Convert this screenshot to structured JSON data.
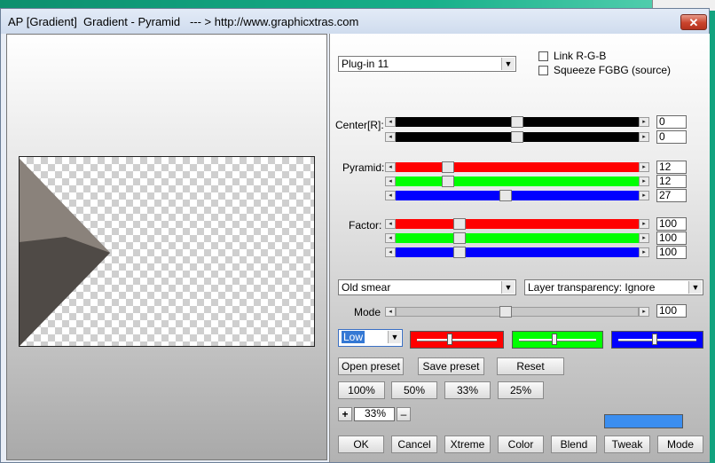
{
  "window": {
    "title": "AP [Gradient]  Gradient - Pyramid   --- > http://www.graphicxtras.com",
    "close_glyph": "✕"
  },
  "controls": {
    "plugin_select": {
      "value": "Plug-in 11"
    },
    "checkboxes": [
      {
        "label": "Link R-G-B",
        "checked": false
      },
      {
        "label": "Squeeze FGBG (source)",
        "checked": false
      }
    ]
  },
  "groups": {
    "center": {
      "label": "Center[R]:",
      "sliders": [
        {
          "color": "#000000",
          "value": "0",
          "fraction": 0.5
        },
        {
          "color": "#000000",
          "value": "0",
          "fraction": 0.5
        }
      ]
    },
    "pyramid": {
      "label": "Pyramid:",
      "sliders": [
        {
          "color": "#ff0000",
          "value": "12",
          "fraction": 0.2
        },
        {
          "color": "#00ff00",
          "value": "12",
          "fraction": 0.2
        },
        {
          "color": "#0000ff",
          "value": "27",
          "fraction": 0.45
        }
      ]
    },
    "factor": {
      "label": "Factor:",
      "sliders": [
        {
          "color": "#ff0000",
          "value": "100",
          "fraction": 0.25
        },
        {
          "color": "#00ff00",
          "value": "100",
          "fraction": 0.25
        },
        {
          "color": "#0000ff",
          "value": "100",
          "fraction": 0.25
        }
      ]
    }
  },
  "blend": {
    "mode_select": "Old smear",
    "transparency_select": "Layer transparency: Ignore",
    "mode_label": "Mode",
    "mode_value": "100",
    "mode_fraction": 0.45
  },
  "quality": {
    "select": "Low",
    "color_sliders": [
      {
        "color": "#ff0000",
        "fraction": 0.4
      },
      {
        "color": "#00ff00",
        "fraction": 0.45
      },
      {
        "color": "#0000ff",
        "fraction": 0.45
      }
    ]
  },
  "buttons": {
    "open_preset": "Open preset",
    "save_preset": "Save preset",
    "reset": "Reset",
    "zoom": [
      "100%",
      "50%",
      "33%",
      "25%"
    ],
    "zoom_plus": "+",
    "zoom_value": "33%",
    "zoom_minus": "–",
    "bottom": [
      "OK",
      "Cancel",
      "Xtreme",
      "Color",
      "Blend",
      "Tweak",
      "Mode"
    ]
  },
  "swatch_color": "#3b8ef0"
}
